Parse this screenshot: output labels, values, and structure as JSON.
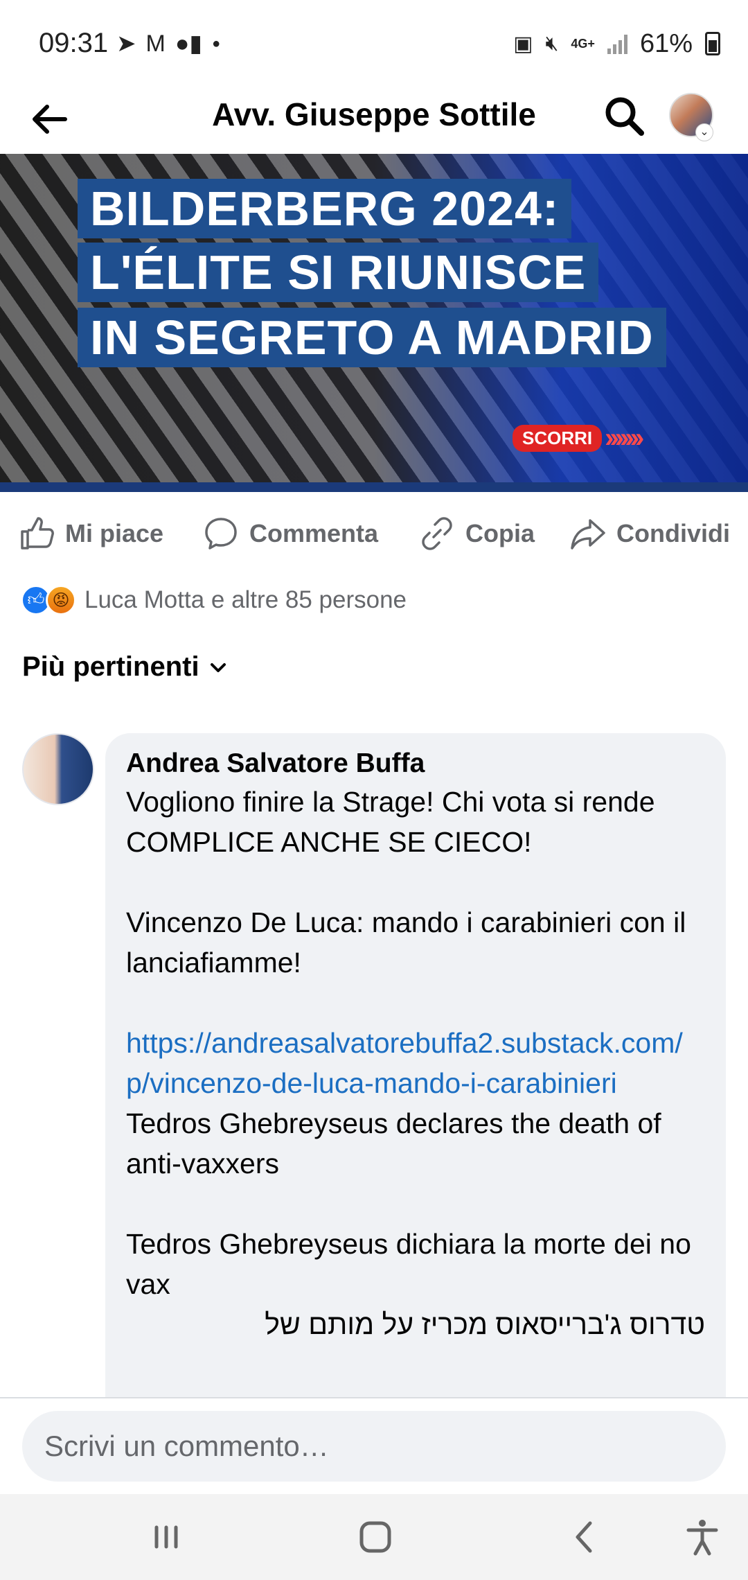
{
  "status_bar": {
    "time": "09:31",
    "battery": "61%",
    "network": "4G+"
  },
  "header": {
    "title": "Avv. Giuseppe Sottile"
  },
  "post_image": {
    "headline_lines": [
      "BILDERBERG 2024:",
      "L'ÉLITE SI RIUNISCE",
      "IN SEGRETO A MADRID"
    ],
    "cta": "SCORRI",
    "cta_arrows": "›››››››"
  },
  "actions": {
    "like": "Mi piace",
    "comment": "Commenta",
    "copy": "Copia",
    "share": "Condividi"
  },
  "reactions": {
    "summary": "Luca Motta e altre 85 persone"
  },
  "sort": {
    "label": "Più pertinenti"
  },
  "comment": {
    "author": "Andrea Salvatore Buffa",
    "lines": [
      "Vogliono finire la Strage! Chi vota si rende COMPLICE ANCHE SE CIECO!",
      "Vincenzo De Luca: mando i carabinieri con il lanciafiamme!"
    ],
    "link": "https://andreasalvatorebuffa2.substack.com/p/vincenzo-de-luca-mando-i-carabinieri",
    "after_link": [
      "Tedros Ghebreyseus declares the death of anti-vaxxers",
      "Tedros Ghebreyseus dichiara la morte dei no vax"
    ],
    "hebrew": "טדרוס ג'ברייסאוס מכריז על מותם של"
  },
  "composer": {
    "placeholder": "Scrivi un commento…"
  }
}
